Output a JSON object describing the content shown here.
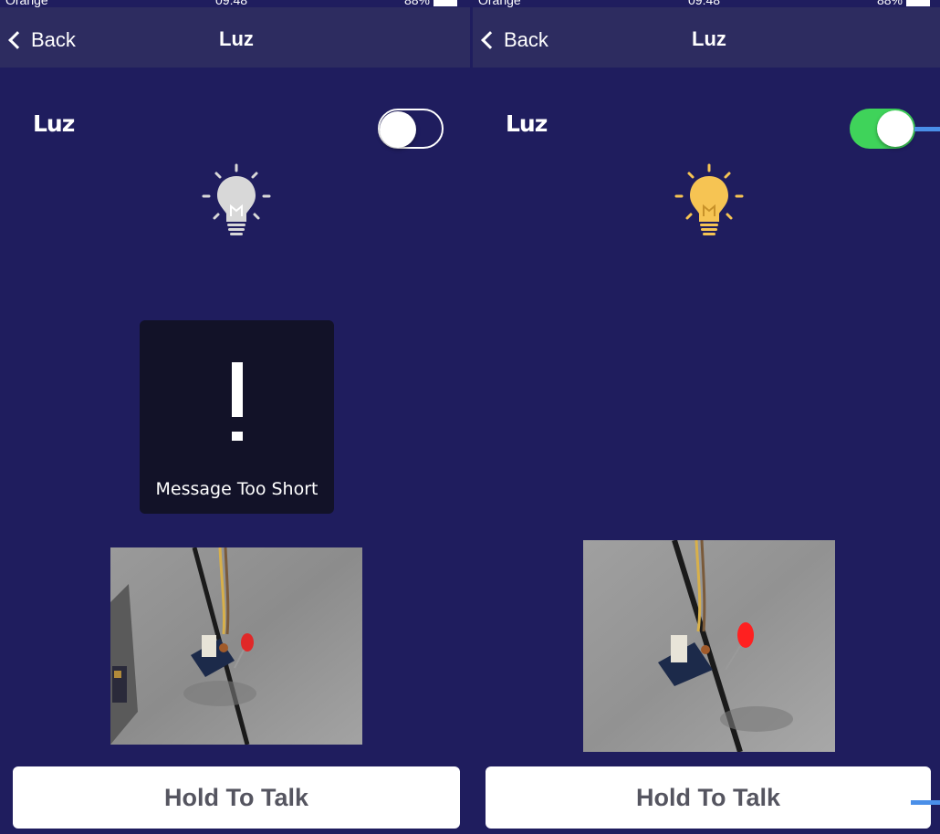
{
  "colors": {
    "background": "#1f1d5e",
    "nav_bar": "#2d2c60",
    "toggle_on": "#3fd35a",
    "bulb_on": "#f6c453",
    "bulb_off": "#d8d8d8",
    "toast_bg": "#121228",
    "annotation": "#4a8fe8"
  },
  "screens": [
    {
      "status": {
        "carrier": "Orange",
        "time": "09:48",
        "battery": "88%"
      },
      "nav": {
        "back_label": "Back",
        "title": "Luz"
      },
      "device": {
        "label": "Luz",
        "toggle_state": "off",
        "bulb_icon": "lightbulb-off-icon"
      },
      "toast": {
        "icon": "exclamation-icon",
        "message": "Message Too Short"
      },
      "camera": {
        "description_icon": "camera-feed"
      },
      "talk_button": {
        "label": "Hold To Talk"
      }
    },
    {
      "status": {
        "carrier": "Orange",
        "time": "09:48",
        "battery": "88%"
      },
      "nav": {
        "back_label": "Back",
        "title": "Luz"
      },
      "device": {
        "label": "Luz",
        "toggle_state": "on",
        "bulb_icon": "lightbulb-on-icon"
      },
      "camera": {
        "description_icon": "camera-feed"
      },
      "talk_button": {
        "label": "Hold To Talk"
      }
    }
  ]
}
